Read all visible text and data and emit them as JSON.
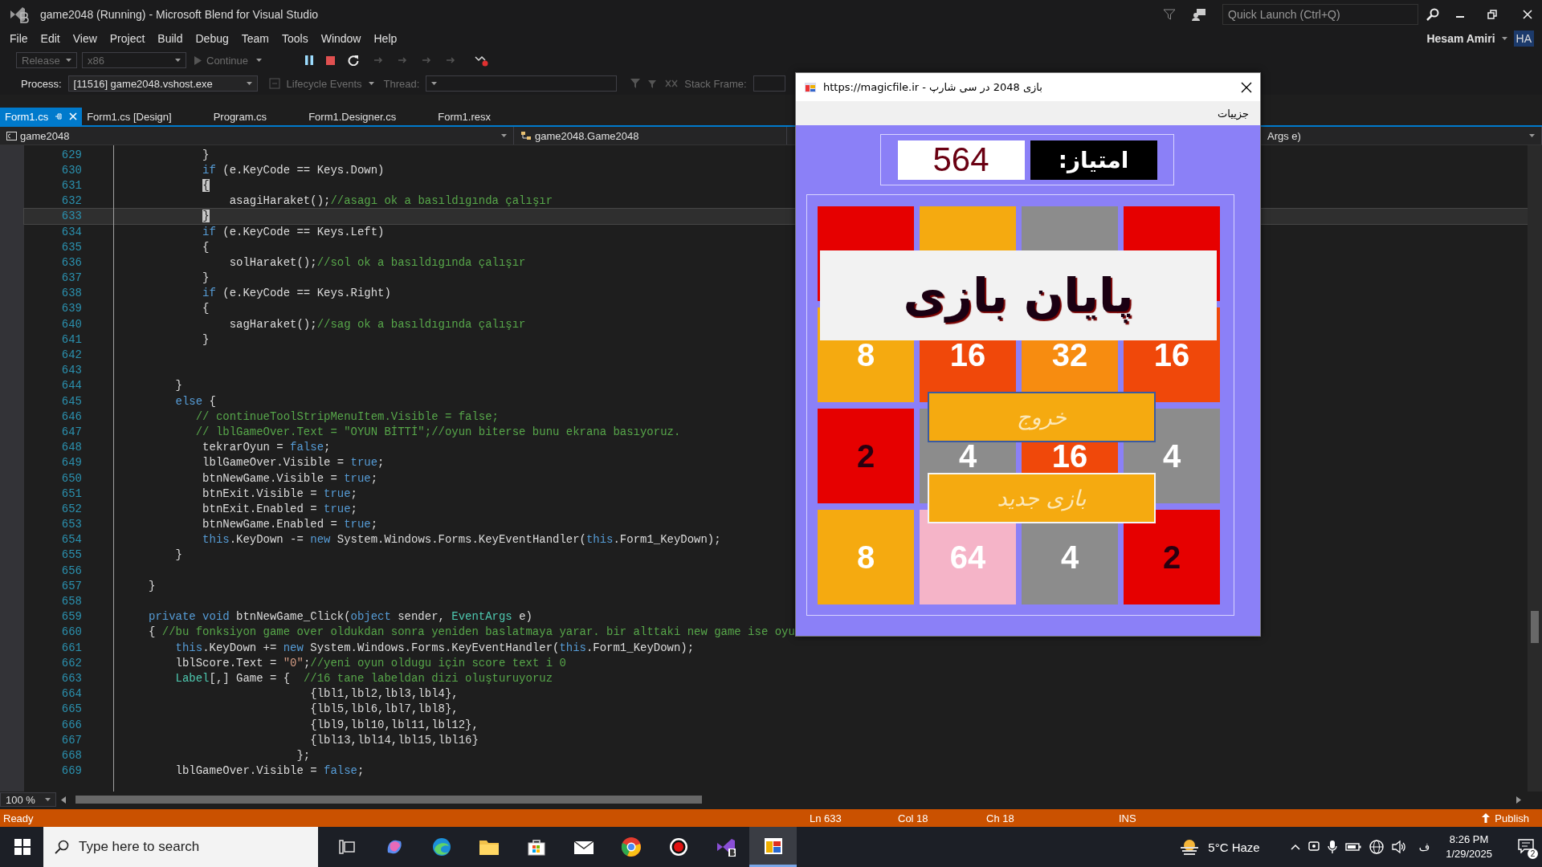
{
  "window": {
    "title": "game2048 (Running) - Microsoft Blend for Visual Studio",
    "quick_launch": {
      "placeholder": "Quick Launch (Ctrl+Q)"
    },
    "user": "Hesam Amiri",
    "avatar": "HA"
  },
  "menu": [
    "File",
    "Edit",
    "View",
    "Project",
    "Build",
    "Debug",
    "Team",
    "Tools",
    "Window",
    "Help"
  ],
  "toolbar": {
    "configuration": "Release",
    "platform": "x86",
    "continue": "Continue"
  },
  "debug_bar": {
    "process_label": "Process:",
    "process": "[11516] game2048.vshost.exe",
    "lifecycle": "Lifecycle Events",
    "thread_label": "Thread:",
    "stack_frame_label": "Stack Frame:"
  },
  "tabs": [
    {
      "label": "Form1.cs",
      "selected": true
    },
    {
      "label": "Form1.cs [Design]",
      "selected": false
    },
    {
      "label": "Program.cs",
      "selected": false
    },
    {
      "label": "Form1.Designer.cs",
      "selected": false
    },
    {
      "label": "Form1.resx",
      "selected": false
    }
  ],
  "nav": {
    "project": "game2048",
    "type": "game2048.Game2048",
    "member": "Args e)"
  },
  "code": [
    {
      "number": "629",
      "highlighted": false,
      "segments": [
        {
          "kind": "pl",
          "text": "                }"
        }
      ]
    },
    {
      "number": "630",
      "highlighted": false,
      "segments": [
        {
          "kind": "kw",
          "text": "                if"
        },
        {
          "kind": "pl",
          "text": " (e.KeyCode == Keys.Down)"
        }
      ]
    },
    {
      "number": "631",
      "highlighted": false,
      "segments": [
        {
          "kind": "hb",
          "text": "                {"
        }
      ]
    },
    {
      "number": "632",
      "highlighted": false,
      "segments": [
        {
          "kind": "pl",
          "text": "                    asagiHaraket();"
        },
        {
          "kind": "cm",
          "text": "//asagı ok a basıldıgında çalışır"
        }
      ]
    },
    {
      "number": "633",
      "highlighted": true,
      "segments": [
        {
          "kind": "hb",
          "text": "                }"
        }
      ]
    },
    {
      "number": "634",
      "highlighted": false,
      "segments": [
        {
          "kind": "kw",
          "text": "                if"
        },
        {
          "kind": "pl",
          "text": " (e.KeyCode == Keys.Left)"
        }
      ]
    },
    {
      "number": "635",
      "highlighted": false,
      "segments": [
        {
          "kind": "pl",
          "text": "                {"
        }
      ]
    },
    {
      "number": "636",
      "highlighted": false,
      "segments": [
        {
          "kind": "pl",
          "text": "                    solHaraket();"
        },
        {
          "kind": "cm",
          "text": "//sol ok a basıldıgında çalışır"
        }
      ]
    },
    {
      "number": "637",
      "highlighted": false,
      "segments": [
        {
          "kind": "pl",
          "text": "                }"
        }
      ]
    },
    {
      "number": "638",
      "highlighted": false,
      "segments": [
        {
          "kind": "kw",
          "text": "                if"
        },
        {
          "kind": "pl",
          "text": " (e.KeyCode == Keys.Right)"
        }
      ]
    },
    {
      "number": "639",
      "highlighted": false,
      "segments": [
        {
          "kind": "pl",
          "text": "                {"
        }
      ]
    },
    {
      "number": "640",
      "highlighted": false,
      "segments": [
        {
          "kind": "pl",
          "text": "                    sagHaraket();"
        },
        {
          "kind": "cm",
          "text": "//sag ok a basıldıgında çalışır"
        }
      ]
    },
    {
      "number": "641",
      "highlighted": false,
      "segments": [
        {
          "kind": "pl",
          "text": "                }"
        }
      ]
    },
    {
      "number": "642",
      "highlighted": false
    },
    {
      "number": "643",
      "highlighted": false
    },
    {
      "number": "644",
      "highlighted": false,
      "segments": [
        {
          "kind": "pl",
          "text": "            }"
        }
      ]
    },
    {
      "number": "645",
      "highlighted": false,
      "segments": [
        {
          "kind": "kw",
          "text": "            else"
        },
        {
          "kind": "pl",
          "text": " {"
        }
      ]
    },
    {
      "number": "646",
      "highlighted": false,
      "segments": [
        {
          "kind": "cm",
          "text": "               // continueToolStripMenuItem.Visible = false;"
        }
      ]
    },
    {
      "number": "647",
      "highlighted": false,
      "segments": [
        {
          "kind": "cm",
          "text": "               // lblGameOver.Text = \"OYUN BİTTİ\";//oyun biterse bunu ekrana basıyoruz."
        }
      ]
    },
    {
      "number": "648",
      "highlighted": false,
      "segments": [
        {
          "kind": "pl",
          "text": "                tekrarOyun = "
        },
        {
          "kind": "kw",
          "text": "false"
        },
        {
          "kind": "pl",
          "text": ";"
        }
      ]
    },
    {
      "number": "649",
      "highlighted": false,
      "segments": [
        {
          "kind": "pl",
          "text": "                lblGameOver.Visible = "
        },
        {
          "kind": "kw",
          "text": "true"
        },
        {
          "kind": "pl",
          "text": ";"
        }
      ]
    },
    {
      "number": "650",
      "highlighted": false,
      "segments": [
        {
          "kind": "pl",
          "text": "                btnNewGame.Visible = "
        },
        {
          "kind": "kw",
          "text": "true"
        },
        {
          "kind": "pl",
          "text": ";"
        }
      ]
    },
    {
      "number": "651",
      "highlighted": false,
      "segments": [
        {
          "kind": "pl",
          "text": "                btnExit.Visible = "
        },
        {
          "kind": "kw",
          "text": "true"
        },
        {
          "kind": "pl",
          "text": ";"
        }
      ]
    },
    {
      "number": "652",
      "highlighted": false,
      "segments": [
        {
          "kind": "pl",
          "text": "                btnExit.Enabled = "
        },
        {
          "kind": "kw",
          "text": "true"
        },
        {
          "kind": "pl",
          "text": ";"
        }
      ]
    },
    {
      "number": "653",
      "highlighted": false,
      "segments": [
        {
          "kind": "pl",
          "text": "                btnNewGame.Enabled = "
        },
        {
          "kind": "kw",
          "text": "true"
        },
        {
          "kind": "pl",
          "text": ";"
        }
      ]
    },
    {
      "number": "654",
      "highlighted": false,
      "segments": [
        {
          "kind": "kw",
          "text": "                this"
        },
        {
          "kind": "pl",
          "text": ".KeyDown -= "
        },
        {
          "kind": "kw",
          "text": "new"
        },
        {
          "kind": "pl",
          "text": " System.Windows.Forms.KeyEventHandler("
        },
        {
          "kind": "kw",
          "text": "this"
        },
        {
          "kind": "pl",
          "text": ".Form1_KeyDown);"
        }
      ]
    },
    {
      "number": "655",
      "highlighted": false,
      "segments": [
        {
          "kind": "pl",
          "text": "            }"
        }
      ]
    },
    {
      "number": "656",
      "highlighted": false
    },
    {
      "number": "657",
      "highlighted": false,
      "segments": [
        {
          "kind": "pl",
          "text": "        }"
        }
      ]
    },
    {
      "number": "658",
      "highlighted": false
    },
    {
      "number": "659",
      "highlighted": false,
      "segments": [
        {
          "kind": "kw",
          "text": "        private void"
        },
        {
          "kind": "pl",
          "text": " btnNewGame_Click("
        },
        {
          "kind": "kw",
          "text": "object"
        },
        {
          "kind": "pl",
          "text": " sender, "
        },
        {
          "kind": "ty",
          "text": "EventArgs"
        },
        {
          "kind": "pl",
          "text": " e)"
        }
      ]
    },
    {
      "number": "660",
      "highlighted": false,
      "segments": [
        {
          "kind": "pl",
          "text": "        { "
        },
        {
          "kind": "cm",
          "text": "//bu fonksiyon game over oldukdan sonra yeniden baslatmaya yarar. bir alttaki new game ise oyu"
        }
      ]
    },
    {
      "number": "661",
      "highlighted": false,
      "segments": [
        {
          "kind": "kw",
          "text": "            this"
        },
        {
          "kind": "pl",
          "text": ".KeyDown += "
        },
        {
          "kind": "kw",
          "text": "new"
        },
        {
          "kind": "pl",
          "text": " System.Windows.Forms.KeyEventHandler("
        },
        {
          "kind": "kw",
          "text": "this"
        },
        {
          "kind": "pl",
          "text": ".Form1_KeyDown);"
        }
      ]
    },
    {
      "number": "662",
      "highlighted": false,
      "segments": [
        {
          "kind": "pl",
          "text": "            lblScore.Text = "
        },
        {
          "kind": "st",
          "text": "\"0\""
        },
        {
          "kind": "pl",
          "text": ";"
        },
        {
          "kind": "cm",
          "text": "//yeni oyun oldugu için score text i 0"
        }
      ]
    },
    {
      "number": "663",
      "highlighted": false,
      "segments": [
        {
          "kind": "ty",
          "text": "            Label"
        },
        {
          "kind": "pl",
          "text": "[,] Game = {  "
        },
        {
          "kind": "cm",
          "text": "//16 tane labeldan dizi oluşturuyoruz"
        }
      ]
    },
    {
      "number": "664",
      "highlighted": false,
      "segments": [
        {
          "kind": "pl",
          "text": "                                {lbl1,lbl2,lbl3,lbl4},"
        }
      ]
    },
    {
      "number": "665",
      "highlighted": false,
      "segments": [
        {
          "kind": "pl",
          "text": "                                {lbl5,lbl6,lbl7,lbl8},"
        }
      ]
    },
    {
      "number": "666",
      "highlighted": false,
      "segments": [
        {
          "kind": "pl",
          "text": "                                {lbl9,lbl10,lbl11,lbl12},"
        }
      ]
    },
    {
      "number": "667",
      "highlighted": false,
      "segments": [
        {
          "kind": "pl",
          "text": "                                {lbl13,lbl14,lbl15,lbl16}"
        }
      ]
    },
    {
      "number": "668",
      "highlighted": false,
      "segments": [
        {
          "kind": "pl",
          "text": "                              };"
        }
      ]
    },
    {
      "number": "669",
      "highlighted": false,
      "segments": [
        {
          "kind": "pl",
          "text": "            lblGameOver.Visible = "
        },
        {
          "kind": "kw",
          "text": "false"
        },
        {
          "kind": "pl",
          "text": ";"
        }
      ]
    }
  ],
  "zoom": "100 %",
  "status_bar": {
    "state": "Ready",
    "line": "Ln 633",
    "column": "Col 18",
    "char": "Ch 18",
    "mode": "INS",
    "publish": "Publish"
  },
  "game": {
    "title": "https://magicfile.ir - بازی 2048 در سی شارپ",
    "menu": "جزییات",
    "score_label": "امتیاز:",
    "score": "564",
    "rows": [
      {
        "tiles": [
          {
            "color": "#e60000"
          },
          {
            "color": "#f5aa10"
          },
          {
            "color": "#8c8c8c"
          },
          {
            "color": "#e60000"
          }
        ]
      },
      {
        "tiles": [
          {
            "color": "#f5aa10",
            "value": "8",
            "dark": false
          },
          {
            "color": "#f0480a",
            "value": "16",
            "dark": false
          },
          {
            "color": "#f78c10",
            "value": "32",
            "dark": false
          },
          {
            "color": "#f0480a",
            "value": "16",
            "dark": false
          }
        ]
      },
      {
        "tiles": [
          {
            "color": "#e60000",
            "value": "2",
            "dark": true
          },
          {
            "color": "#8c8c8c",
            "value": "4",
            "dark": false
          },
          {
            "color": "#f0480a",
            "value": "16",
            "dark": false
          },
          {
            "color": "#8c8c8c",
            "value": "4",
            "dark": false
          }
        ]
      },
      {
        "tiles": [
          {
            "color": "#f5aa10",
            "value": "8",
            "dark": false
          },
          {
            "color": "#f5b4c8",
            "value": "64",
            "dark": false
          },
          {
            "color": "#8c8c8c",
            "value": "4",
            "dark": false
          },
          {
            "color": "#e60000",
            "value": "2",
            "dark": true
          }
        ]
      }
    ],
    "game_over": "پایان بازی",
    "buttons": [
      {
        "label": "خروج",
        "focused": true
      },
      {
        "label": "بازی جدید",
        "focused": false
      }
    ]
  },
  "taskbar": {
    "search": {
      "placeholder": "Type here to search"
    },
    "apps": [
      {
        "selected": false
      },
      {
        "selected": false
      },
      {
        "selected": false
      },
      {
        "selected": false
      },
      {
        "selected": false
      },
      {
        "selected": false
      },
      {
        "selected": false
      },
      {
        "selected": false
      },
      {
        "selected": false
      },
      {
        "selected": true
      }
    ],
    "weather": "5°C Haze",
    "language": "ف",
    "time": "8:26 PM",
    "date": "1/29/2025",
    "notifications": "2"
  }
}
